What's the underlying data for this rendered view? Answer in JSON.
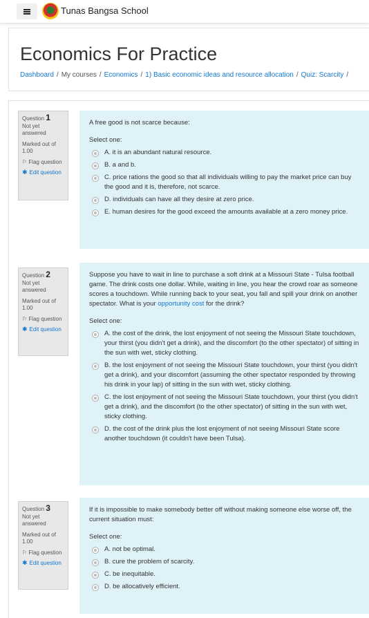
{
  "navbar": {
    "site_name": "Tunas Bangsa School",
    "menu_icon": "hamburger-icon",
    "logo_icon": "school-logo"
  },
  "header": {
    "title": "Economics For Practice",
    "breadcrumb": [
      {
        "label": "Dashboard",
        "link": true
      },
      {
        "label": "My courses",
        "link": false
      },
      {
        "label": "Economics",
        "link": true
      },
      {
        "label": "1) Basic economic ideas and resource allocation",
        "link": true
      },
      {
        "label": "Quiz: Scarcity",
        "link": true
      }
    ]
  },
  "labels": {
    "question_prefix": "Question",
    "status": "Not yet answered",
    "marked": "Marked out of 1.00",
    "flag": "Flag question",
    "edit": "Edit question",
    "select_one": "Select one:"
  },
  "questions": [
    {
      "number": "1",
      "text": "A free good is not scarce because:",
      "answers": [
        "A. it is an abundant natural resource.",
        "B. a and b.",
        "C. price rations the good so that all individuals willing to pay the market price can buy the good and it is, therefore, not scarce.",
        "D. individuals can have all they desire at zero price.",
        "E. human desires for the good exceed the amounts available at a zero money price."
      ]
    },
    {
      "number": "2",
      "text_before_link": "Suppose you have to wait in line to purchase a soft drink at a Missouri State - Tulsa football game. The drink costs one dollar. While, waiting in line, you hear the crowd roar as someone scores a touchdown. While running back to your seat, you fall and spill your drink on another spectator. What is your ",
      "text_link": "opportunity cost",
      "text_after_link": " for the drink?",
      "answers": [
        "A. the cost of the drink, the lost enjoyment of not seeing the Missouri State touchdown, your thirst (you didn't get a drink), and the discomfort (to the other spectator) of sitting in the sun with wet, sticky clothing.",
        "B. the lost enjoyment of not seeing the Missouri State touchdown, your thirst (you didn't get a drink), and your discomfort (assuming the other spectator responded by throwing his drink in your lap) of sitting in the sun with wet, sticky clothing.",
        "C. the lost enjoyment of not seeing the Missouri State touchdown, your thirst (you didn't get a drink), and the discomfort (to the other spectator) of sitting in the sun with wet, sticky clothing.",
        "D. the cost of the drink plus the lost enjoyment of not seeing Missouri State score another touchdown (it couldn't have been Tulsa)."
      ]
    },
    {
      "number": "3",
      "text": "If it is impossible to make somebody better off without making someone else worse off, the current situation must:",
      "answers": [
        "A. not be optimal.",
        "B. cure the problem of scarcity.",
        "C. be inequitable.",
        "D. be allocatively efficient."
      ]
    }
  ]
}
